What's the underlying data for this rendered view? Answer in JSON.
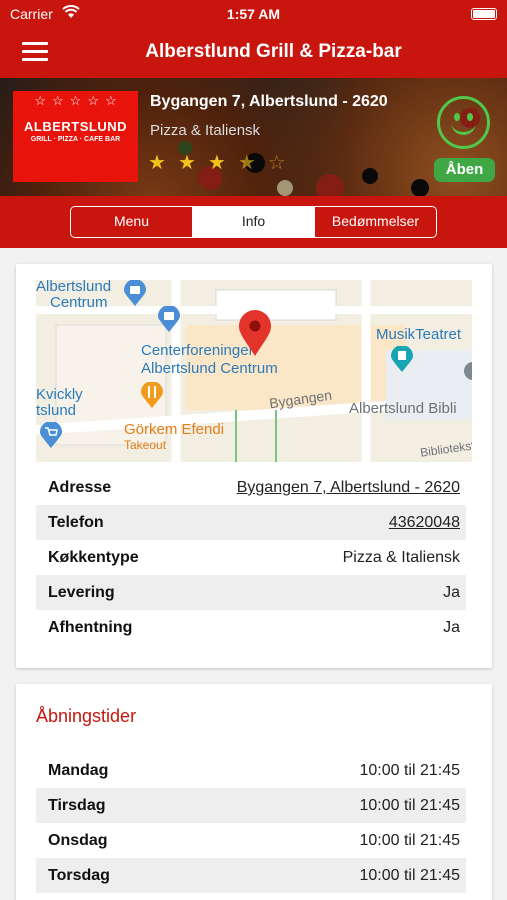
{
  "status_bar": {
    "carrier": "Carrier",
    "time": "1:57 AM"
  },
  "nav": {
    "title": "Alberstlund Grill & Pizza-bar"
  },
  "restaurant": {
    "logo_name": "ALBERTSLUND",
    "logo_tagline": "GRILL · PIZZA · CAFE BAR",
    "logo_stars": "☆☆☆☆☆",
    "address": "Bygangen 7, Albertslund - 2620",
    "category": "Pizza & Italiensk",
    "rating": 3.5,
    "status_badge": "Åben",
    "smiley_color": "#50c84b"
  },
  "tabs": [
    {
      "label": "Menu"
    },
    {
      "label": "Info"
    },
    {
      "label": "Bedømmelser"
    }
  ],
  "map": {
    "labels": [
      "Albertslund",
      "Centrum",
      "Centerforeningen",
      "Albertslund Centrum",
      "Bygangen",
      "MusikTeatret",
      "Albertslund Bibli",
      "Görkem Efendi",
      "Takeout",
      "Kvickly",
      "tslund",
      "Bibliotekst"
    ]
  },
  "info": [
    {
      "key": "Adresse",
      "value": "Bygangen 7, Albertslund - 2620"
    },
    {
      "key": "Telefon",
      "value": "43620048"
    },
    {
      "key": "Køkkentype",
      "value": "Pizza & Italiensk"
    },
    {
      "key": "Levering",
      "value": "Ja"
    },
    {
      "key": "Afhentning",
      "value": "Ja"
    }
  ],
  "hours": {
    "title": "Åbningstider",
    "days": [
      {
        "day": "Mandag",
        "time": "10:00 til 21:45"
      },
      {
        "day": "Tirsdag",
        "time": "10:00 til 21:45"
      },
      {
        "day": "Onsdag",
        "time": "10:00 til 21:45"
      },
      {
        "day": "Torsdag",
        "time": "10:00 til 21:45"
      }
    ]
  },
  "colors": {
    "brand": "#c8150d",
    "open": "#3fa845",
    "star": "#f4c21c"
  }
}
